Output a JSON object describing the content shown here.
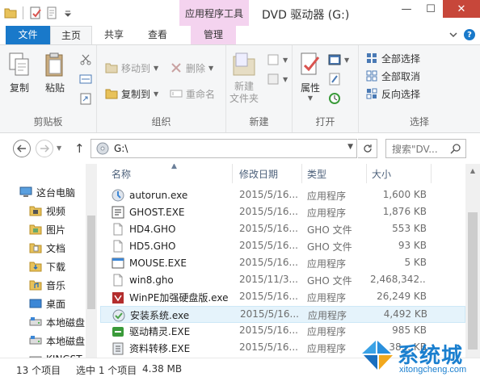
{
  "titlebar": {
    "context_group": "应用程序工具",
    "window_title": "DVD 驱动器 (G:)",
    "minimize_glyph": "—",
    "maximize_glyph": "☐",
    "close_glyph": "✕"
  },
  "tabs": {
    "file": "文件",
    "home": "主页",
    "share": "共享",
    "view": "查看",
    "manage": "管理"
  },
  "ribbon": {
    "clipboard": {
      "label": "剪贴板",
      "copy": "复制",
      "paste": "粘贴"
    },
    "organize": {
      "label": "组织",
      "move_to": "移动到",
      "copy_to": "复制到",
      "delete": "删除",
      "rename": "重命名"
    },
    "new": {
      "label": "新建",
      "new_folder": "新建\n文件夹"
    },
    "open": {
      "label": "打开",
      "properties": "属性"
    },
    "select": {
      "label": "选择",
      "select_all": "全部选择",
      "select_none": "全部取消",
      "invert": "反向选择"
    }
  },
  "address": {
    "path": "G:\\",
    "search_placeholder": "搜索\"DV..."
  },
  "navpane": {
    "items": [
      {
        "label": "这台电脑",
        "icon": "computer-icon",
        "indent": 0
      },
      {
        "label": "视频",
        "icon": "video-folder-icon",
        "indent": 1
      },
      {
        "label": "图片",
        "icon": "pictures-folder-icon",
        "indent": 1
      },
      {
        "label": "文档",
        "icon": "documents-folder-icon",
        "indent": 1
      },
      {
        "label": "下载",
        "icon": "downloads-folder-icon",
        "indent": 1
      },
      {
        "label": "音乐",
        "icon": "music-folder-icon",
        "indent": 1
      },
      {
        "label": "桌面",
        "icon": "desktop-folder-icon",
        "indent": 1
      },
      {
        "label": "本地磁盘",
        "icon": "local-disk-icon",
        "indent": 1
      },
      {
        "label": "本地磁盘",
        "icon": "local-disk-icon",
        "indent": 1
      },
      {
        "label": "KINGST",
        "icon": "usb-drive-icon",
        "indent": 1
      }
    ]
  },
  "filelist": {
    "columns": {
      "name": "名称",
      "date": "修改日期",
      "type": "类型",
      "size": "大小"
    },
    "rows": [
      {
        "name": "autorun.exe",
        "date": "2015/5/16...",
        "type": "应用程序",
        "size": "1,600 KB",
        "icon": "autorun-exe-icon",
        "selected": false
      },
      {
        "name": "GHOST.EXE",
        "date": "2015/5/16...",
        "type": "应用程序",
        "size": "1,876 KB",
        "icon": "ghost-exe-icon",
        "selected": false
      },
      {
        "name": "HD4.GHO",
        "date": "2015/5/16...",
        "type": "GHO 文件",
        "size": "553 KB",
        "icon": "gho-file-icon",
        "selected": false
      },
      {
        "name": "HD5.GHO",
        "date": "2015/5/16...",
        "type": "GHO 文件",
        "size": "93 KB",
        "icon": "gho-file-icon",
        "selected": false
      },
      {
        "name": "MOUSE.EXE",
        "date": "2015/5/16...",
        "type": "应用程序",
        "size": "5 KB",
        "icon": "mouse-exe-icon",
        "selected": false
      },
      {
        "name": "win8.gho",
        "date": "2015/11/3...",
        "type": "GHO 文件",
        "size": "2,468,342...",
        "icon": "gho-file-icon",
        "selected": false
      },
      {
        "name": "WinPE加强硬盘版.exe",
        "date": "2015/5/16...",
        "type": "应用程序",
        "size": "26,249 KB",
        "icon": "winpe-exe-icon",
        "selected": false
      },
      {
        "name": "安装系统.exe",
        "date": "2015/5/16...",
        "type": "应用程序",
        "size": "4,492 KB",
        "icon": "install-system-exe-icon",
        "selected": true
      },
      {
        "name": "驱动精灵.EXE",
        "date": "2015/5/16...",
        "type": "应用程序",
        "size": "985 KB",
        "icon": "driver-genius-exe-icon",
        "selected": false
      },
      {
        "name": "资料转移.EXE",
        "date": "2015/5/16...",
        "type": "应用程序",
        "size": "38... KB",
        "icon": "data-transfer-exe-icon",
        "selected": false
      }
    ]
  },
  "statusbar": {
    "count": "13 个项目",
    "selected": "选中 1 个项目",
    "size": "4.38 MB"
  },
  "watermark": {
    "text": "系统城",
    "url": "xitongcheng.com"
  },
  "colors": {
    "accent": "#1979ca",
    "context_tab": "#f4d3ef",
    "close": "#c7473a",
    "selection": "#e5f3fb"
  }
}
